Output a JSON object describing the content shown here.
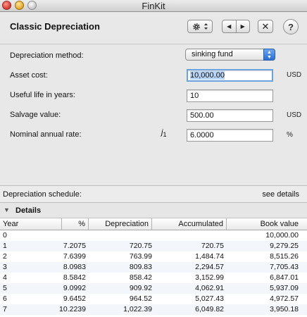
{
  "window": {
    "title": "FinKit"
  },
  "header": {
    "title": "Classic Depreciation",
    "prev_symbol": "◀",
    "next_symbol": "▶",
    "close_symbol": "✕",
    "help_symbol": "?"
  },
  "form": {
    "method": {
      "label": "Depreciation method:",
      "value": "sinking fund"
    },
    "asset_cost": {
      "label": "Asset cost:",
      "value": "10,000.00",
      "unit": "USD"
    },
    "useful_life": {
      "label": "Useful life in years:",
      "value": "10"
    },
    "salvage": {
      "label": "Salvage value:",
      "value": "500.00",
      "unit": "USD"
    },
    "rate": {
      "label": "Nominal annual rate:",
      "symbol": "j",
      "symbol_sub": "1",
      "value": "6.0000",
      "unit": "%"
    }
  },
  "schedule": {
    "label": "Depreciation schedule:",
    "link": "see details"
  },
  "details": {
    "label": "Details"
  },
  "table": {
    "columns": [
      "Year",
      "%",
      "Depreciation",
      "Accumulated",
      "Book value"
    ],
    "rows": [
      [
        "0",
        "",
        "",
        "",
        "10,000.00"
      ],
      [
        "1",
        "7.2075",
        "720.75",
        "720.75",
        "9,279.25"
      ],
      [
        "2",
        "7.6399",
        "763.99",
        "1,484.74",
        "8,515.26"
      ],
      [
        "3",
        "8.0983",
        "809.83",
        "2,294.57",
        "7,705.43"
      ],
      [
        "4",
        "8.5842",
        "858.42",
        "3,152.99",
        "6,847.01"
      ],
      [
        "5",
        "9.0992",
        "909.92",
        "4,062.91",
        "5,937.09"
      ],
      [
        "6",
        "9.6452",
        "964.52",
        "5,027.43",
        "4,972.57"
      ],
      [
        "7",
        "10.2239",
        "1,022.39",
        "6,049.82",
        "3,950.18"
      ]
    ]
  },
  "colors": {
    "focus_ring": "#6da2e0",
    "select_arrow": "#2b6fd6"
  }
}
